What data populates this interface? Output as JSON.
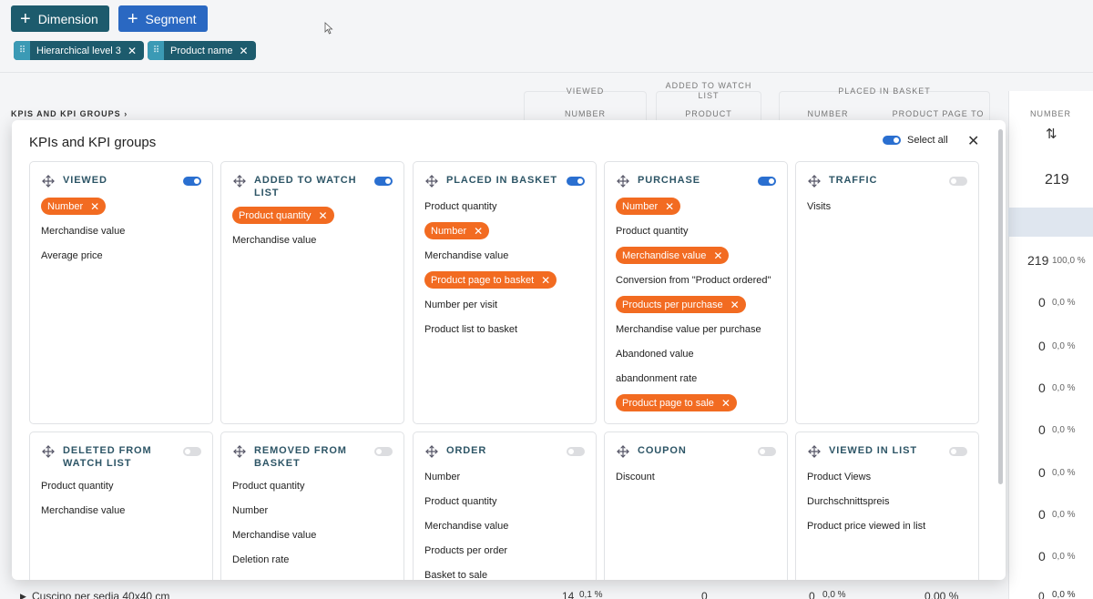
{
  "toolbar": {
    "dimension_label": "Dimension",
    "segment_label": "Segment"
  },
  "chips": [
    {
      "label": "Hierarchical level 3"
    },
    {
      "label": "Product name"
    }
  ],
  "table": {
    "kpi_crumb": "KPIS AND KPI GROUPS",
    "headers": {
      "viewed": "VIEWED",
      "viewed_sub": "NUMBER",
      "added": "ADDED TO WATCH LIST",
      "added_sub": "PRODUCT",
      "placed": "PLACED IN BASKET",
      "placed_sub1": "NUMBER",
      "placed_sub2": "PRODUCT PAGE TO",
      "number": "NUMBER",
      "sort_icon": "sort-arrows-icon"
    },
    "total": "219",
    "rows": [
      {
        "value": "219",
        "pct": "100,0 %"
      },
      {
        "value": "0",
        "pct": "0,0 %"
      },
      {
        "value": "0",
        "pct": "0,0 %"
      },
      {
        "value": "0",
        "pct": "0,0 %"
      },
      {
        "value": "0",
        "pct": "0,0 %"
      },
      {
        "value": "0",
        "pct": "0,0 %"
      },
      {
        "value": "0",
        "pct": "0,0 %"
      },
      {
        "value": "0",
        "pct": "0,0 %"
      }
    ],
    "bottom_row": {
      "name": "Cuscino per sedia 40x40 cm",
      "v1": "14",
      "v1pct": "0,1 %",
      "v2": "0",
      "v3": "0",
      "v3pct": "0,0 %",
      "v4": "0,00 %",
      "v5": "0",
      "v5pct": "0,0 %"
    }
  },
  "modal": {
    "title": "KPIs and KPI groups",
    "select_all_label": "Select all",
    "close_icon": "close-icon",
    "cards": [
      {
        "title": "Viewed",
        "enabled": true,
        "items": [
          {
            "label": "Number",
            "selected": true
          },
          {
            "label": "Merchandise value",
            "selected": false
          },
          {
            "label": "Average price",
            "selected": false
          }
        ]
      },
      {
        "title": "Added to watch list",
        "enabled": true,
        "items": [
          {
            "label": "Product quantity",
            "selected": true
          },
          {
            "label": "Merchandise value",
            "selected": false
          }
        ]
      },
      {
        "title": "Placed in basket",
        "enabled": true,
        "items": [
          {
            "label": "Product quantity",
            "selected": false
          },
          {
            "label": "Number",
            "selected": true
          },
          {
            "label": "Merchandise value",
            "selected": false
          },
          {
            "label": "Product page to basket",
            "selected": true
          },
          {
            "label": "Number per visit",
            "selected": false
          },
          {
            "label": "Product list to basket",
            "selected": false
          }
        ]
      },
      {
        "title": "Purchase",
        "enabled": true,
        "items": [
          {
            "label": "Number",
            "selected": true
          },
          {
            "label": "Product quantity",
            "selected": false
          },
          {
            "label": "Merchandise value",
            "selected": true
          },
          {
            "label": "Conversion from \"Product ordered\"",
            "selected": false
          },
          {
            "label": "Products per purchase",
            "selected": true
          },
          {
            "label": "Merchandise value per purchase",
            "selected": false
          },
          {
            "label": "Abandoned value",
            "selected": false
          },
          {
            "label": "abandonment rate",
            "selected": false
          },
          {
            "label": "Product page to sale",
            "selected": true
          }
        ]
      },
      {
        "title": "Traffic",
        "enabled": false,
        "items": [
          {
            "label": "Visits",
            "selected": false
          }
        ]
      },
      {
        "title": "Deleted from watch list",
        "enabled": false,
        "items": [
          {
            "label": "Product quantity",
            "selected": false
          },
          {
            "label": "Merchandise value",
            "selected": false
          }
        ]
      },
      {
        "title": "Removed from basket",
        "enabled": false,
        "items": [
          {
            "label": "Product quantity",
            "selected": false
          },
          {
            "label": "Number",
            "selected": false
          },
          {
            "label": "Merchandise value",
            "selected": false
          },
          {
            "label": "Deletion rate",
            "selected": false
          }
        ]
      },
      {
        "title": "Order",
        "enabled": false,
        "items": [
          {
            "label": "Number",
            "selected": false
          },
          {
            "label": "Product quantity",
            "selected": false
          },
          {
            "label": "Merchandise value",
            "selected": false
          },
          {
            "label": "Products per order",
            "selected": false
          },
          {
            "label": "Basket to sale",
            "selected": false
          }
        ]
      },
      {
        "title": "Coupon",
        "enabled": false,
        "items": [
          {
            "label": "Discount",
            "selected": false
          }
        ]
      },
      {
        "title": "Viewed in list",
        "enabled": false,
        "items": [
          {
            "label": "Product Views",
            "selected": false
          },
          {
            "label": "Durchschnittspreis",
            "selected": false
          },
          {
            "label": "Product price viewed in list",
            "selected": false
          }
        ]
      }
    ]
  }
}
